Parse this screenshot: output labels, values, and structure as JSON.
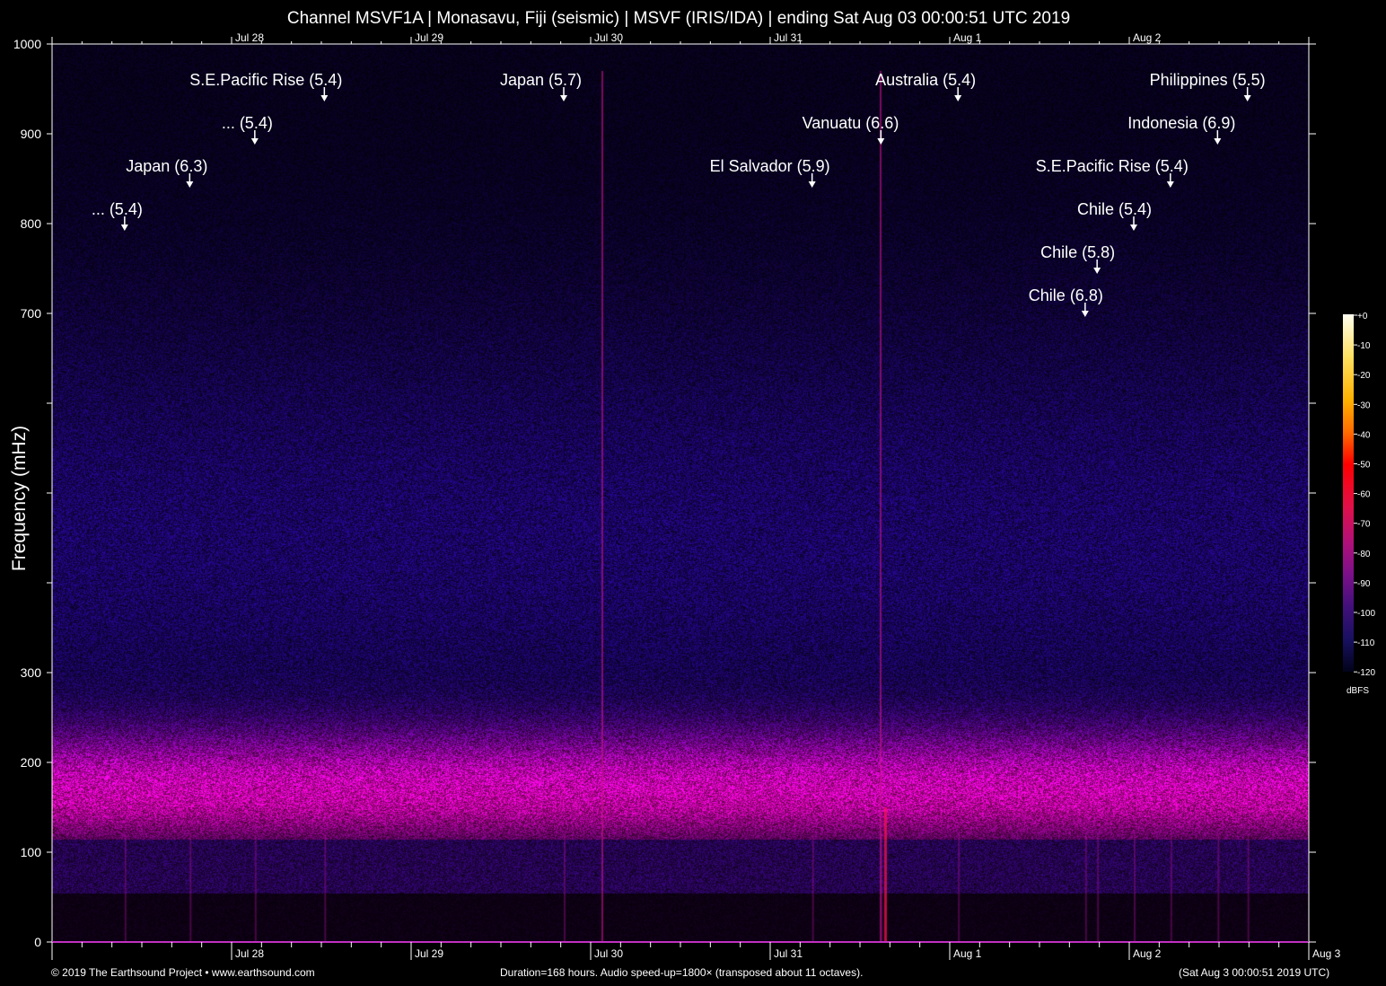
{
  "title": "Channel MSVF1A | Monasavu, Fiji (seismic) | MSVF (IRIS/IDA) | ending Sat Aug 03 00:00:51 UTC 2019",
  "footer": {
    "left": "© 2019 The Earthsound Project • www.earthsound.com",
    "center": "Duration=168 hours. Audio speed-up=1800× (transposed about 11 octaves).",
    "right": "(Sat Aug  3 00:00:51 2019 UTC)"
  },
  "chart_data": {
    "type": "heatmap",
    "title": "Channel MSVF1A | Monasavu, Fiji (seismic) | MSVF (IRIS/IDA) | ending Sat Aug 03 00:00:51 UTC 2019",
    "ylabel": "Frequency (mHz)",
    "ylim": [
      0,
      1000
    ],
    "y_ticks": [
      0,
      100,
      200,
      300,
      400,
      500,
      600,
      700,
      800,
      900,
      1000
    ],
    "y_tick_labels": [
      "0",
      "100",
      "200",
      "300",
      "",
      "",
      "",
      "700",
      "800",
      "900",
      "1000"
    ],
    "x_duration_hours": 168,
    "x_ticks": [
      {
        "hour": 24,
        "label": "Jul 28"
      },
      {
        "hour": 48,
        "label": "Jul 29"
      },
      {
        "hour": 72,
        "label": "Jul 30"
      },
      {
        "hour": 96,
        "label": "Jul 31"
      },
      {
        "hour": 120,
        "label": "Aug  1"
      },
      {
        "hour": 144,
        "label": "Aug  2"
      },
      {
        "hour": 168,
        "label": "Aug  3"
      }
    ],
    "colorbar": {
      "unit": "dBFS",
      "ticks": [
        "+0",
        "-10",
        "-20",
        "-30",
        "-40",
        "-50",
        "-60",
        "-70",
        "-80",
        "-90",
        "-100",
        "-110",
        "-120"
      ],
      "range": [
        -120,
        0
      ]
    },
    "events": [
      {
        "label": "... (5.4)",
        "hour": 9.7,
        "freq": 792
      },
      {
        "label": "Japan (6.3)",
        "hour": 18.4,
        "freq": 840
      },
      {
        "label": "... (5.4)",
        "hour": 27.1,
        "freq": 888
      },
      {
        "label": "S.E.Pacific Rise (5.4)",
        "hour": 36.4,
        "freq": 936
      },
      {
        "label": "Japan (5.7)",
        "hour": 68.4,
        "freq": 936
      },
      {
        "label": "El Salvador (5.9)",
        "hour": 101.6,
        "freq": 840
      },
      {
        "label": "Vanuatu (6.6)",
        "hour": 110.8,
        "freq": 888
      },
      {
        "label": "Australia (5.4)",
        "hour": 121.1,
        "freq": 936
      },
      {
        "label": "Chile (6.8)",
        "hour": 138.1,
        "freq": 696
      },
      {
        "label": "Chile (5.8)",
        "hour": 139.7,
        "freq": 744
      },
      {
        "label": "Chile (5.4)",
        "hour": 144.6,
        "freq": 792
      },
      {
        "label": "S.E.Pacific Rise (5.4)",
        "hour": 149.5,
        "freq": 840
      },
      {
        "label": "Indonesia (6.9)",
        "hour": 155.8,
        "freq": 888
      },
      {
        "label": "Philippines (5.5)",
        "hour": 159.8,
        "freq": 936
      }
    ]
  }
}
